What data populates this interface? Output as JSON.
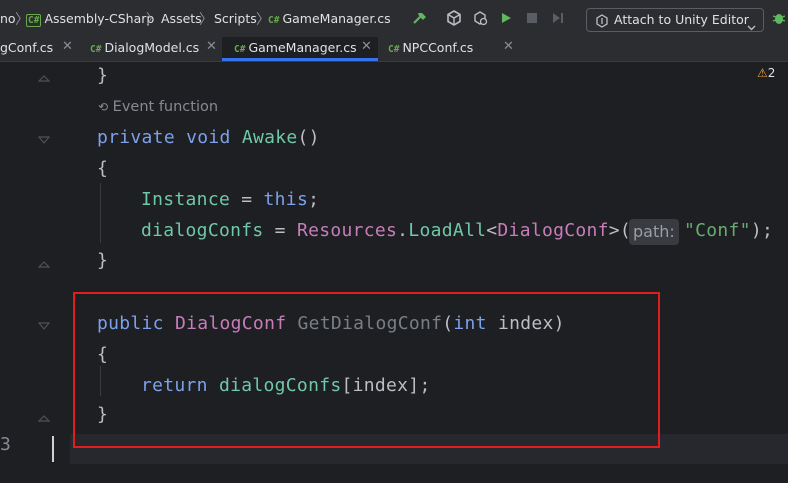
{
  "breadcrumbs": [
    "no",
    "Assembly-CSharp",
    "Assets",
    "Scripts",
    "GameManager.cs"
  ],
  "cs_badge": "C#",
  "attach_button": {
    "label": "Attach to Unity Editor"
  },
  "tabs": [
    {
      "label": "gConf.cs",
      "active": false
    },
    {
      "label": "DialogModel.cs",
      "active": false
    },
    {
      "label": "GameManager.cs",
      "active": true
    },
    {
      "label": "NPCConf.cs",
      "active": false
    }
  ],
  "editor": {
    "warning_count": "2",
    "hint_event_function": "Event function",
    "lines": {
      "l1_brace": "}",
      "awake_private": "private",
      "awake_void": "void",
      "awake_name": "Awake",
      "awake_parens": "()",
      "open_brace": "{",
      "instance_lhs": "Instance",
      "instance_eq": " = ",
      "instance_this": "this",
      "instance_semi": ";",
      "dc_lhs": "dialogConfs",
      "dc_eq": " = ",
      "dc_resources": "Resources",
      "dc_dot": ".",
      "dc_loadall": "LoadAll",
      "dc_lt": "<",
      "dc_type": "DialogConf",
      "dc_gt": ">(",
      "dc_param_hint": "path:",
      "dc_str": "\"Conf\"",
      "dc_end": ");",
      "close_brace": "}",
      "get_public": "public",
      "get_type": "DialogConf",
      "get_name": "GetDialogConf",
      "get_open": "(",
      "get_int": "int",
      "get_param": " index",
      "get_close": ")",
      "get_open_brace": "{",
      "ret_kw": "return",
      "ret_expr": "dialogConfs",
      "ret_index": "[index];",
      "get_close_brace": "}"
    },
    "gutter_label": "3"
  },
  "colors": {
    "highlight_box": "#e01e1e",
    "active_tab_underline": "#3574f0"
  }
}
